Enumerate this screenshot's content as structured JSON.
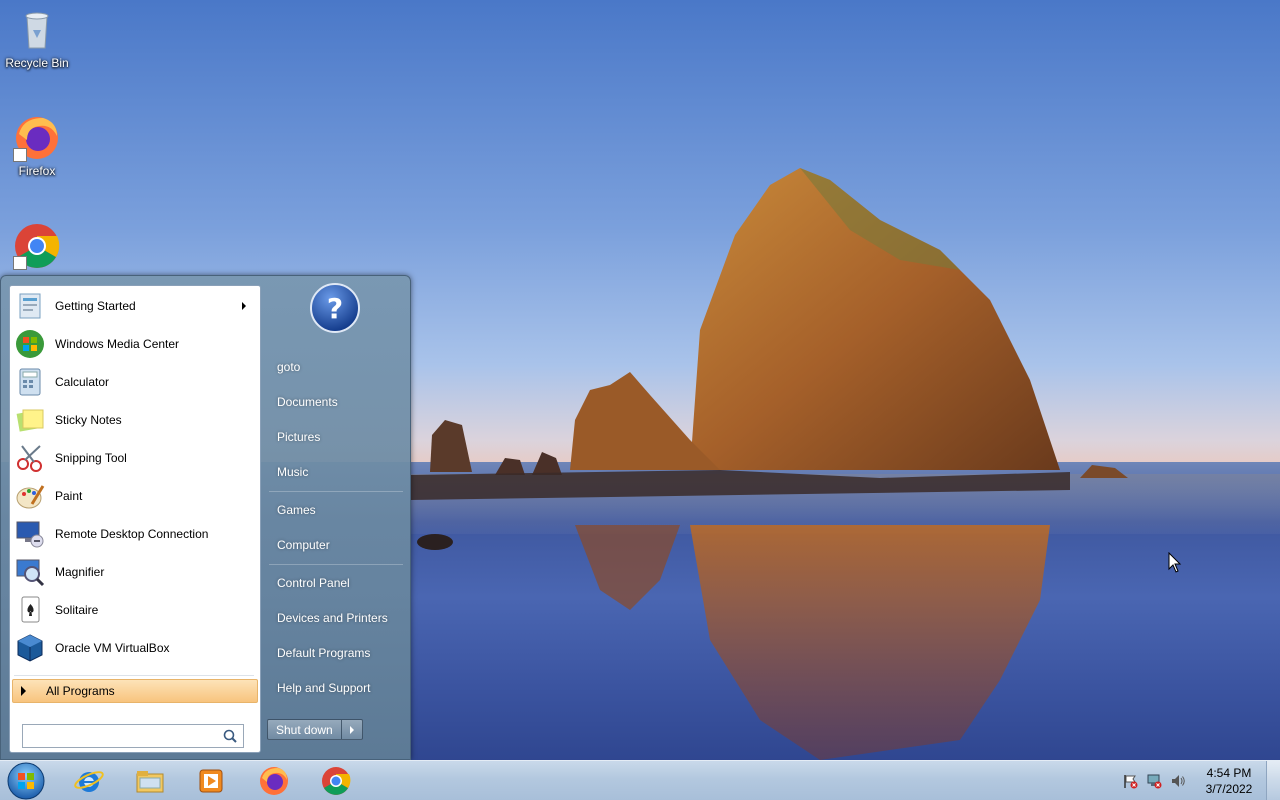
{
  "desktop": {
    "icons": [
      {
        "label": "Recycle Bin",
        "icon": "recycle-bin-icon"
      },
      {
        "label": "Firefox",
        "icon": "firefox-icon"
      },
      {
        "label": "",
        "icon": "chrome-icon"
      }
    ]
  },
  "start_menu": {
    "programs": [
      {
        "label": "Getting Started",
        "icon": "getting-started-icon",
        "has_submenu": true
      },
      {
        "label": "Windows Media Center",
        "icon": "windows-media-center-icon"
      },
      {
        "label": "Calculator",
        "icon": "calculator-icon"
      },
      {
        "label": "Sticky Notes",
        "icon": "sticky-notes-icon"
      },
      {
        "label": "Snipping Tool",
        "icon": "snipping-tool-icon"
      },
      {
        "label": "Paint",
        "icon": "paint-icon"
      },
      {
        "label": "Remote Desktop Connection",
        "icon": "remote-desktop-icon"
      },
      {
        "label": "Magnifier",
        "icon": "magnifier-icon"
      },
      {
        "label": "Solitaire",
        "icon": "solitaire-icon"
      },
      {
        "label": "Oracle VM VirtualBox",
        "icon": "virtualbox-icon"
      }
    ],
    "all_programs_label": "All Programs",
    "search": {
      "value": "",
      "placeholder": ""
    },
    "right_pane": {
      "user_icon": "help-icon",
      "items": [
        {
          "label": "goto"
        },
        {
          "label": "Documents"
        },
        {
          "label": "Pictures"
        },
        {
          "label": "Music"
        },
        {
          "label": "Games"
        },
        {
          "label": "Computer"
        },
        {
          "label": "Control Panel"
        },
        {
          "label": "Devices and Printers"
        },
        {
          "label": "Default Programs"
        },
        {
          "label": "Help and Support"
        }
      ]
    },
    "shutdown_label": "Shut down"
  },
  "taskbar": {
    "start_button_icon": "windows-start-orb-icon",
    "pinned_apps": [
      {
        "name": "Internet Explorer",
        "icon": "internet-explorer-icon"
      },
      {
        "name": "Windows Explorer",
        "icon": "file-explorer-icon"
      },
      {
        "name": "Windows Media Player",
        "icon": "media-player-icon"
      },
      {
        "name": "Firefox",
        "icon": "firefox-icon"
      },
      {
        "name": "Google Chrome",
        "icon": "chrome-icon"
      }
    ],
    "tray_icons": [
      "action-center-flag-icon",
      "network-icon",
      "volume-icon"
    ],
    "clock": {
      "time": "4:54 PM",
      "date": "3/7/2022"
    }
  },
  "colors": {
    "all_programs_highlight": "#f8c47e",
    "taskbar": "#b3c8df",
    "start_menu_right": "#6f8aa4"
  }
}
